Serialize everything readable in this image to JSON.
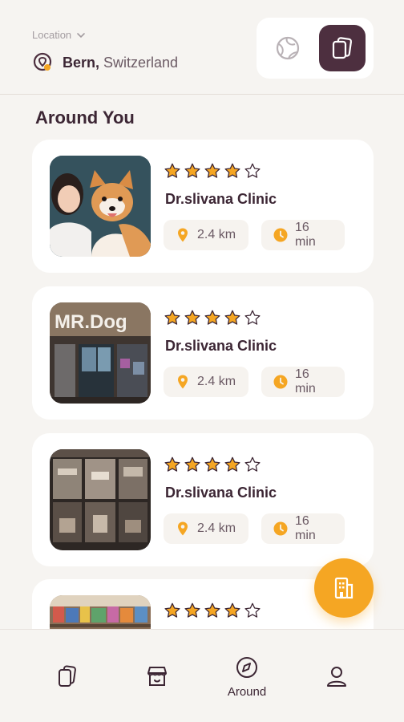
{
  "header": {
    "location_label": "Location",
    "city": "Bern,",
    "country": "Switzerland",
    "view_toggle": {
      "map_icon": "globe-icon",
      "list_icon": "cards-icon",
      "active": "list"
    }
  },
  "section_title": "Around You",
  "clinics": [
    {
      "rating": 4,
      "name": "Dr.slivana Clinic",
      "distance": "2.4 km",
      "time": "16 min",
      "photo": "woman-with-corgi"
    },
    {
      "rating": 4,
      "name": "Dr.slivana Clinic",
      "distance": "2.4 km",
      "time": "16 min",
      "photo": "mr-dog-storefront"
    },
    {
      "rating": 4,
      "name": "Dr.slivana Clinic",
      "distance": "2.4 km",
      "time": "16 min",
      "photo": "shop-window"
    },
    {
      "rating": 4,
      "name": "",
      "distance": "",
      "time": "",
      "photo": "toy-shelves"
    }
  ],
  "fab": {
    "icon": "building-icon"
  },
  "nav": {
    "items": [
      {
        "icon": "cards-icon",
        "label": ""
      },
      {
        "icon": "store-icon",
        "label": ""
      },
      {
        "icon": "compass-icon",
        "label": "Around"
      },
      {
        "icon": "user-icon",
        "label": ""
      }
    ],
    "active": 2
  },
  "colors": {
    "primary": "#4d2f3f",
    "accent": "#f5a623",
    "background": "#f6f4f1",
    "card": "#ffffff"
  }
}
